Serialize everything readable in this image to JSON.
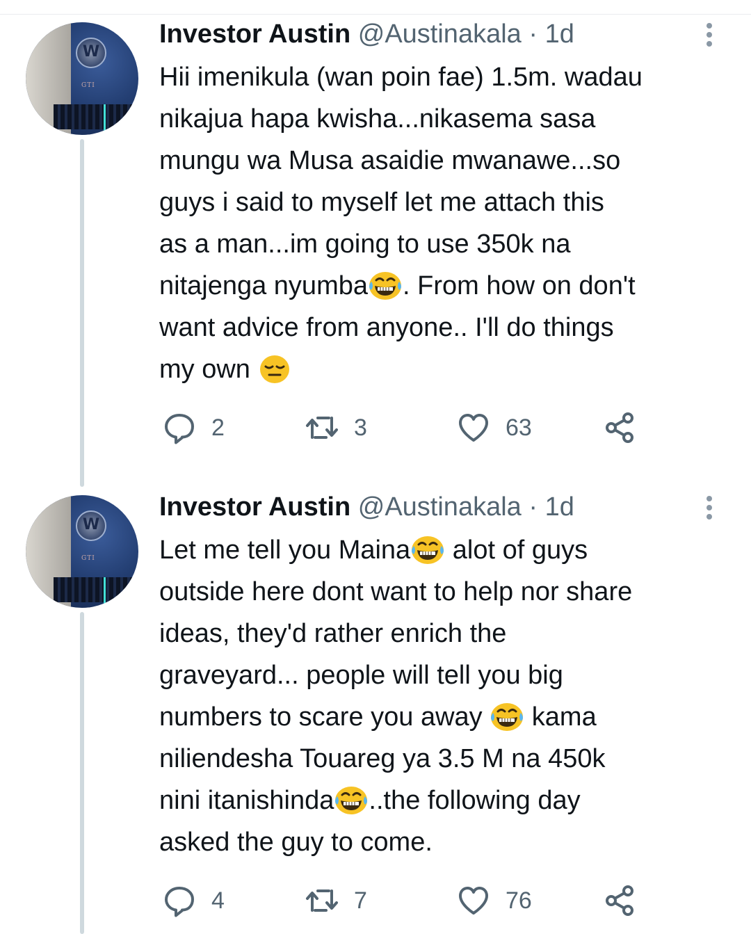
{
  "tweets": [
    {
      "author": "Investor Austin",
      "handle": "@Austinakala",
      "separator": "·",
      "time": "1d",
      "text": [
        "Hii imenikula (wan poin fae) 1.5m. wadau\nnikajua hapa kwisha...nikasema sasa\nmungu wa Musa asaidie mwanawe...so\nguys i said to myself let me attach this\nas a man...im going to use 350k na\nnitajenga nyumba",
        "tears-of-joy-emoji",
        ". From how on don't\nwant advice from anyone.. I'll do things\nmy own ",
        "pensive-emoji"
      ],
      "replies": "2",
      "retweets": "3",
      "likes": "63"
    },
    {
      "author": "Investor Austin",
      "handle": "@Austinakala",
      "separator": "·",
      "time": "1d",
      "text": [
        "Let me tell you Maina",
        "tears-of-joy-emoji",
        " alot of guys\noutside here dont want to help nor share\nideas, they'd rather enrich the\ngraveyard... people will tell you big\nnumbers to scare you away ",
        "tears-of-joy-emoji",
        " kama\nniliendesha Touareg ya 3.5 M na 450k\nnini itanishinda",
        "tears-of-joy-emoji",
        "..the following day\nasked the guy to come."
      ],
      "replies": "4",
      "retweets": "7",
      "likes": "76"
    }
  ],
  "icons": {
    "reply": "reply-icon",
    "retweet": "retweet-icon",
    "like": "heart-icon",
    "share": "share-icon",
    "more": "more-icon"
  },
  "colors": {
    "text": "#0f1419",
    "secondary": "#536471",
    "thread_line": "#cfd9de",
    "emoji": "#f7c325"
  }
}
